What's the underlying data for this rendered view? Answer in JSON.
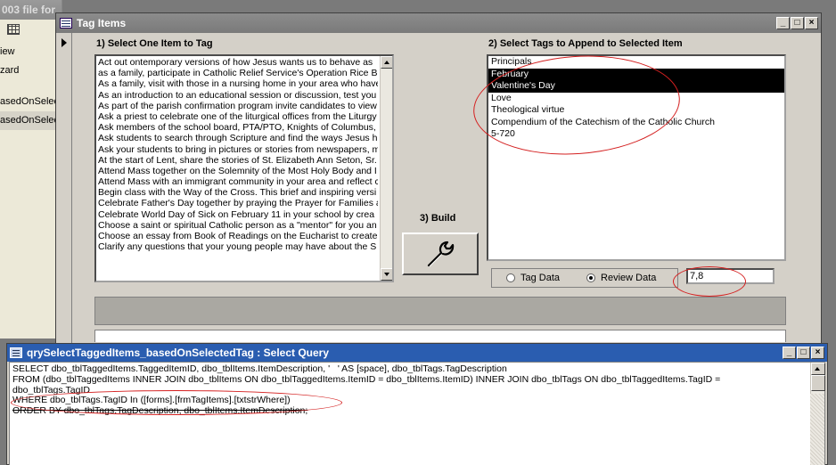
{
  "background_window": {
    "title": "003 file for",
    "items": [
      "iew",
      "zard",
      "",
      "asedOnSelec",
      "asedOnSelec"
    ]
  },
  "tag_window": {
    "title": "Tag Items",
    "controls": {
      "minimize": "_",
      "maximize": "□",
      "close": "×"
    },
    "section1_label": "1) Select One Item to Tag",
    "section2_label": "2) Select Tags to Append to Selected Item",
    "section3_label": "3) Build",
    "items": [
      "Act out ontemporary versions of how Jesus wants us to behave as",
      "as a family, participate in Catholic Relief Service's Operation Rice B",
      "As a family, visit with those in a nursing home in your area who have",
      "As an introduction to an educational session or discussion, test you",
      "As part of the parish confirmation program invite candidates to view",
      "Ask a priest to celebrate one of the liturgical offices from the Liturgy",
      "Ask members of the school board, PTA/PTO, Knights of Columbus,",
      "Ask students to search through Scripture and find the ways Jesus h",
      "Ask your students to bring in pictures or stories from newspapers, m",
      "At the start of Lent, share the stories of St. Elizabeth Ann Seton, Sr.",
      "Attend Mass together on the Solemnity of the Most Holy Body and I",
      "Attend Mass with an immigrant community in your area and reflect c",
      "Begin class with the Way of the Cross. This brief and inspiring versi",
      "Celebrate Father's Day together by praying the Prayer for Families a",
      "Celebrate World Day of Sick on February 11 in your school by crea",
      "Choose a saint or spiritual Catholic person as a \"mentor\" for you an",
      "Choose an essay from Book of Readings on the Eucharist to create",
      "Clarify any questions that your young people may have about the S"
    ],
    "tags": [
      {
        "label": "Principals",
        "selected": false
      },
      {
        "label": "February",
        "selected": true
      },
      {
        "label": "Valentine's Day",
        "selected": true
      },
      {
        "label": "Love",
        "selected": false
      },
      {
        "label": "Theological virtue",
        "selected": false
      },
      {
        "label": "Compendium of the Catechism of the Catholic Church",
        "selected": false
      },
      {
        "label": "5-720",
        "selected": false
      }
    ],
    "options": {
      "tag_data": "Tag Data",
      "review_data": "Review Data",
      "selected": "review_data"
    },
    "where_value": "7,8",
    "build_icon": "wrench-icon",
    "annotation_color": "#d42020"
  },
  "query_window": {
    "title": "qrySelectTaggedItems_basedOnSelectedTag : Select Query",
    "controls": {
      "minimize": "_",
      "maximize": "□",
      "close": "×"
    },
    "sql_lines": [
      "SELECT dbo_tblTaggedItems.TaggedItemID, dbo_tblItems.ItemDescription, '   ' AS [space], dbo_tblTags.TagDescription",
      "FROM (dbo_tblTaggedItems INNER JOIN dbo_tblItems ON dbo_tblTaggedItems.ItemID = dbo_tblItems.ItemID) INNER JOIN dbo_tblTags ON dbo_tblTaggedItems.TagID =",
      "dbo_tblTags.TagID",
      "WHERE dbo_tblTags.TagID In ([forms].[frmTagItems].[txtstrWhere])",
      "ORDER BY dbo_tblTags.TagDescription, dbo_tblItems.ItemDescription;"
    ],
    "title_color": "#2a5db0"
  }
}
